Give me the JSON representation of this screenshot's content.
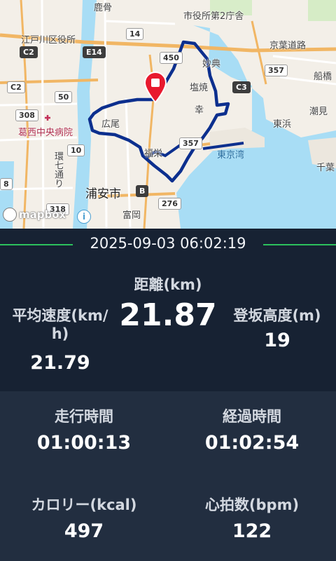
{
  "map": {
    "labels": {
      "kasai_hospital": "葛西中央病院",
      "edogawa_ward_office": "江戸川区役所",
      "city_office_2": "市役所第2庁舎",
      "urayasu": "浦安市",
      "tokyo_bay": "東京湾",
      "keiyo_road": "京葉道路",
      "funabashi": "船橋",
      "shiomi": "潮見",
      "higashihama": "東浜",
      "chiba": "千葉",
      "kanmai": "鹿骨",
      "myoten": "妙典",
      "shiohama": "塩焼",
      "saiwai": "幸",
      "hiroo": "広尾",
      "fukuei": "福栄",
      "tomioka": "富岡",
      "kan7": "環七通り",
      "route_e14": "E14",
      "route_14": "14",
      "route_450": "450",
      "route_357a": "357",
      "route_357b": "357",
      "route_c3": "C3",
      "route_c2": "C2",
      "route_50": "50",
      "route_308": "308",
      "route_10": "10",
      "route_318": "318",
      "route_276": "276",
      "route_b": "B",
      "route_8": "8",
      "route_e": "E"
    },
    "attribution_text": "mapbox",
    "info_icon": "info-icon",
    "marker_icon": "map-pin-icon",
    "route_color": "#0c2f8e",
    "water_color": "#a8ddf5"
  },
  "session": {
    "datetime": "2025-09-03 06:02:19"
  },
  "stats": {
    "distance_label": "距離(km)",
    "distance_value": "21.87",
    "avg_speed_label_1": "平均速度(km/",
    "avg_speed_label_2": "h)",
    "avg_speed_value": "21.79",
    "climb_label": "登坂高度(m)",
    "climb_value": "19",
    "moving_time_label": "走行時間",
    "moving_time_value": "01:00:13",
    "elapsed_time_label": "経過時間",
    "elapsed_time_value": "01:02:54",
    "calories_label": "カロリー(kcal)",
    "calories_value": "497",
    "heart_rate_label": "心拍数(bpm)",
    "heart_rate_value": "122"
  },
  "colors": {
    "accent_green": "#2cc15d",
    "panel_dark": "#172233",
    "panel_mid": "#222e40"
  }
}
